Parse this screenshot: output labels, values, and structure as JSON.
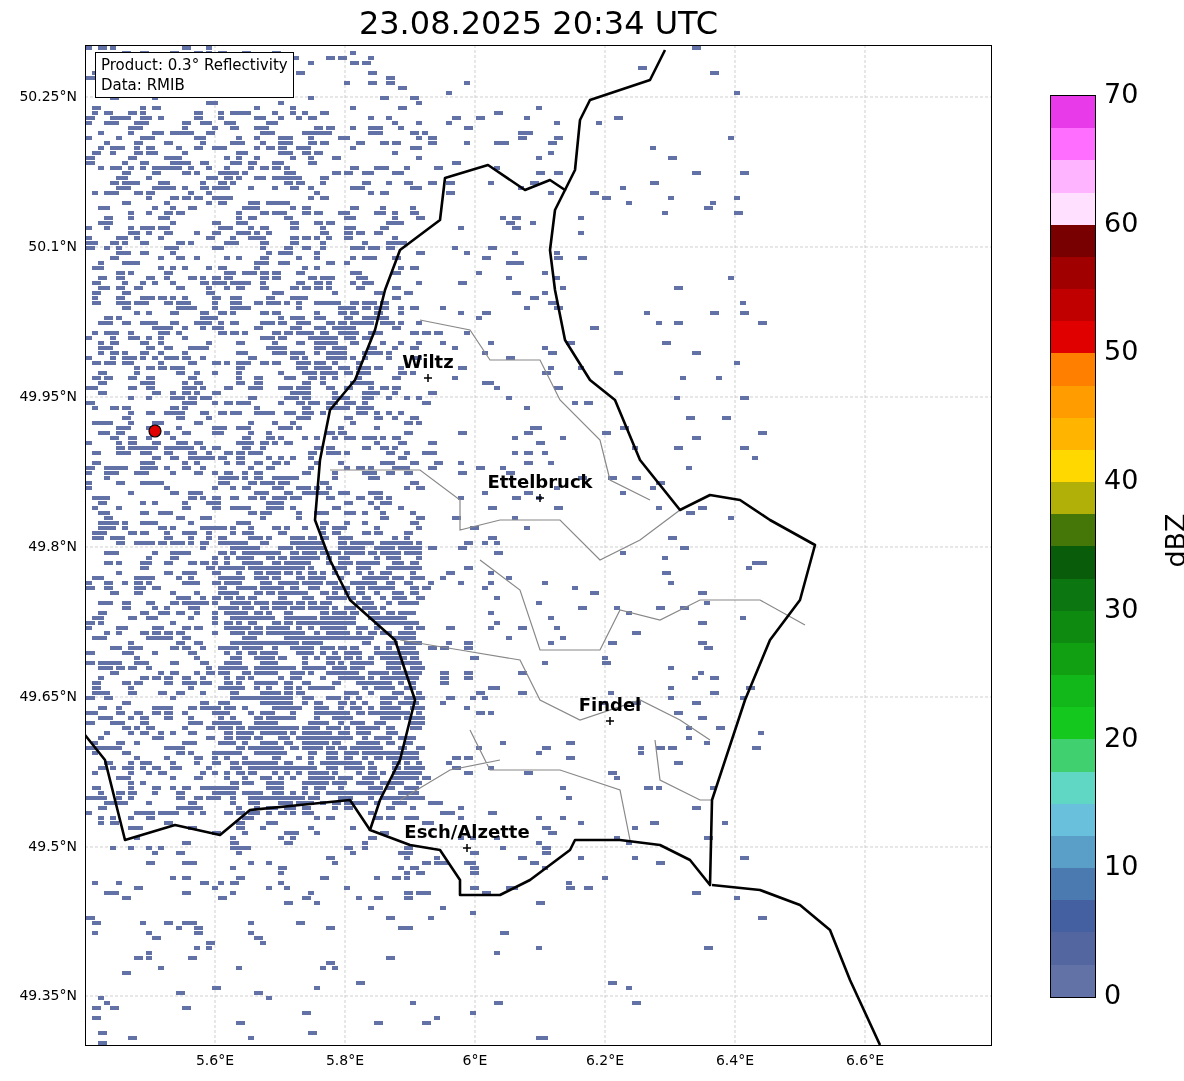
{
  "title": "23.08.2025 20:34 UTC",
  "info_box": [
    "Product: 0.3° Reflectivity",
    "Data: RMIB"
  ],
  "y_ticks": [
    "50.25°N",
    "50.1°N",
    "49.95°N",
    "49.8°N",
    "49.65°N",
    "49.5°N",
    "49.35°N"
  ],
  "x_ticks": [
    "5.6°E",
    "5.8°E",
    "6°E",
    "6.2°E",
    "6.4°E",
    "6.6°E"
  ],
  "cities": [
    {
      "name": "Wiltz"
    },
    {
      "name": "Ettelbruck"
    },
    {
      "name": "Findel"
    },
    {
      "name": "Esch/Alzette"
    }
  ],
  "colorbar": {
    "label": "dBZ",
    "ticks": [
      "70",
      "60",
      "50",
      "40",
      "30",
      "20",
      "10",
      "0"
    ],
    "segments": [
      {
        "color": "#e83ae8"
      },
      {
        "color": "#ff6eff"
      },
      {
        "color": "#ffb4ff"
      },
      {
        "color": "#ffe0ff"
      },
      {
        "color": "#780000"
      },
      {
        "color": "#a00000"
      },
      {
        "color": "#c00000"
      },
      {
        "color": "#e00000"
      },
      {
        "color": "#ff8000"
      },
      {
        "color": "#ff9c00"
      },
      {
        "color": "#ffb400"
      },
      {
        "color": "#ffd800"
      },
      {
        "color": "#b0b008"
      },
      {
        "color": "#447608"
      },
      {
        "color": "#085c0a"
      },
      {
        "color": "#0c7610"
      },
      {
        "color": "#0e8a10"
      },
      {
        "color": "#10a012"
      },
      {
        "color": "#12b81a"
      },
      {
        "color": "#14c81e"
      },
      {
        "color": "#40d070"
      },
      {
        "color": "#60d6c4"
      },
      {
        "color": "#68c0dc"
      },
      {
        "color": "#5a9fc8"
      },
      {
        "color": "#4a7ab0"
      },
      {
        "color": "#4460a0"
      },
      {
        "color": "#5366a0"
      },
      {
        "color": "#6272a6"
      }
    ]
  }
}
